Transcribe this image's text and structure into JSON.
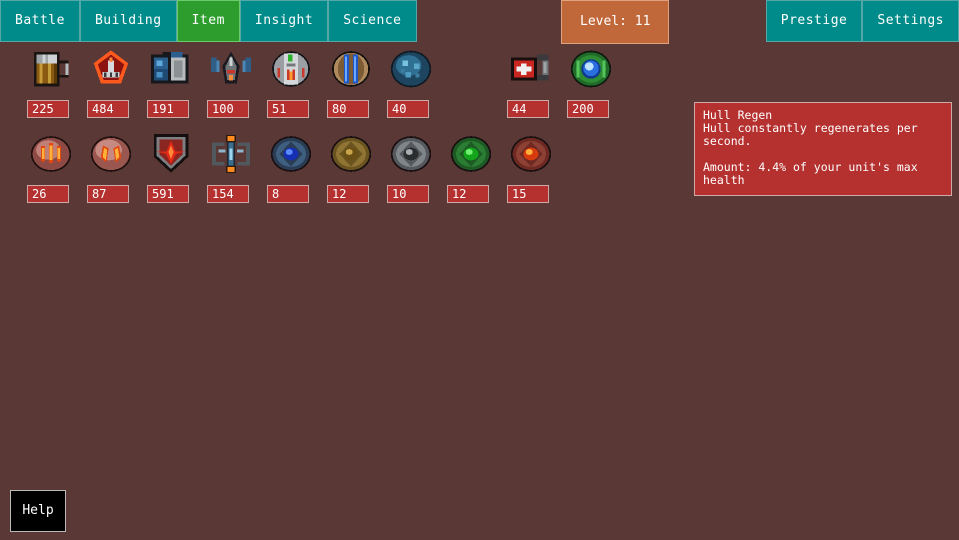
{
  "window": {
    "background_color": "#5a3836"
  },
  "navbar": {
    "tabs": [
      {
        "label": "Battle",
        "name": "tab-battle",
        "active": false
      },
      {
        "label": "Building",
        "name": "tab-building",
        "active": false
      },
      {
        "label": "Item",
        "name": "tab-item",
        "active": true
      },
      {
        "label": "Insight",
        "name": "tab-insight",
        "active": false
      },
      {
        "label": "Science",
        "name": "tab-science",
        "active": false
      }
    ],
    "right_tabs": [
      {
        "label": "Prestige",
        "name": "tab-prestige"
      },
      {
        "label": "Settings",
        "name": "tab-settings"
      }
    ],
    "level_badge": {
      "label": "Level: 11",
      "color": "#c1683a"
    },
    "tab_color": "#008b8b",
    "active_tab_color": "#2d9e2d"
  },
  "items": {
    "badge_color": "#b5312f",
    "rows": [
      {
        "slots": [
          {
            "value": "225",
            "icon": "beer-mug-icon",
            "col": 0
          },
          {
            "value": "484",
            "icon": "red-diamond-helm-icon",
            "col": 1
          },
          {
            "value": "191",
            "icon": "blue-machine-icon",
            "col": 2
          },
          {
            "value": "100",
            "icon": "antenna-drone-icon",
            "col": 3
          },
          {
            "value": "51",
            "icon": "silver-capsule-icon",
            "col": 4
          },
          {
            "value": "80",
            "icon": "blue-rods-pod-icon",
            "col": 5
          },
          {
            "value": "40",
            "icon": "blue-stone-orb-icon",
            "col": 6
          },
          {
            "value": "44",
            "icon": "medkit-icon",
            "col": 8
          },
          {
            "value": "200",
            "icon": "green-blue-orb-icon",
            "col": 9
          }
        ]
      },
      {
        "slots": [
          {
            "value": "26",
            "icon": "red-claw-orb-icon",
            "col": 0
          },
          {
            "value": "87",
            "icon": "red-fang-orb-icon",
            "col": 1
          },
          {
            "value": "591",
            "icon": "red-star-shield-icon",
            "col": 2
          },
          {
            "value": "154",
            "icon": "chain-core-icon",
            "col": 3
          },
          {
            "value": "8",
            "icon": "blue-gem-orb-icon",
            "col": 4
          },
          {
            "value": "12",
            "icon": "gold-gem-orb-icon",
            "col": 5
          },
          {
            "value": "10",
            "icon": "silver-gem-orb-icon",
            "col": 6
          },
          {
            "value": "12",
            "icon": "green-gem-orb-icon",
            "col": 7
          },
          {
            "value": "15",
            "icon": "red-gem-orb-icon",
            "col": 8
          }
        ]
      }
    ]
  },
  "tooltip": {
    "title": "Hull Regen",
    "description": "Hull constantly regenerates per second.",
    "amount": "Amount: 4.4% of your unit's max health"
  },
  "help_button": {
    "label": "Help"
  }
}
